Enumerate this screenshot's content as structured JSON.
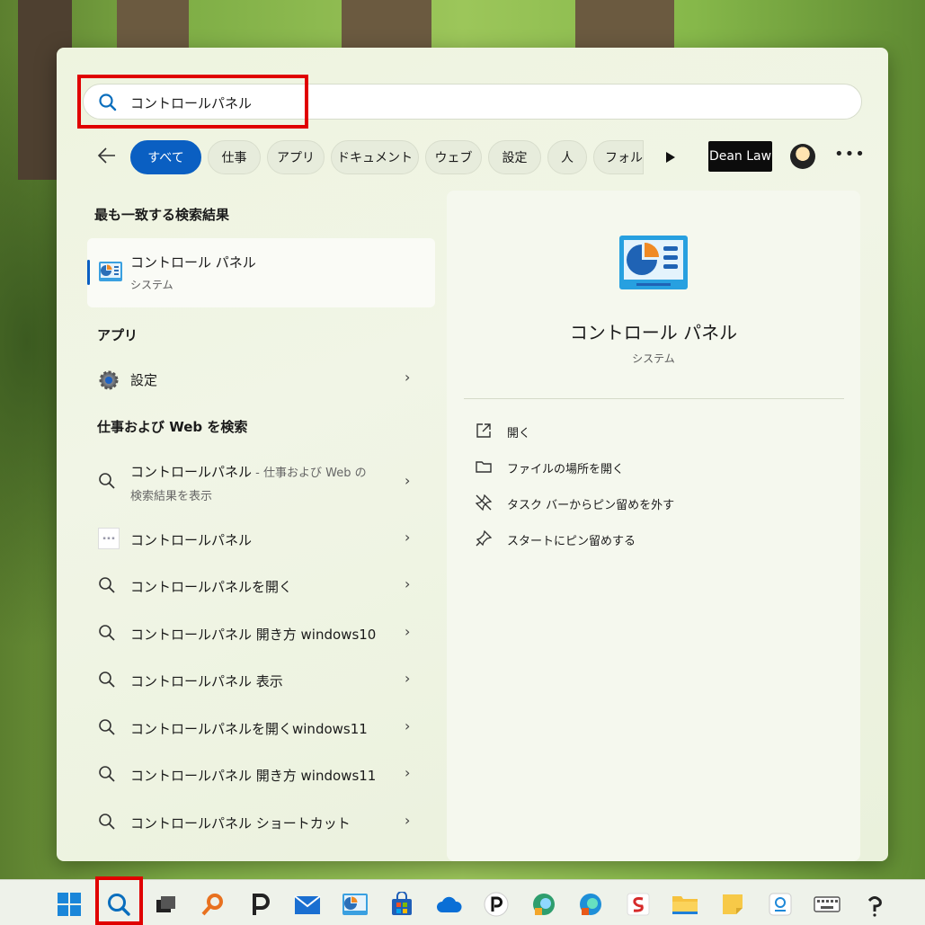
{
  "search": {
    "query": "コントロールパネル"
  },
  "filters": {
    "back_label": "←",
    "chips": [
      "すべて",
      "仕事",
      "アプリ",
      "ドキュメント",
      "ウェブ",
      "設定",
      "人",
      "フォルダ"
    ],
    "account_name": "Dean Law",
    "more_label": "•••"
  },
  "left": {
    "best_match_heading": "最も一致する検索結果",
    "best_match": {
      "title": "コントロール パネル",
      "subtitle": "システム"
    },
    "apps_heading": "アプリ",
    "apps": [
      {
        "label": "設定"
      }
    ],
    "web_heading": "仕事および Web を検索",
    "web_first": {
      "main": "コントロールパネル",
      "suffix": " - 仕事および Web の検索結果を表示"
    },
    "web_results": [
      "コントロールパネル",
      "コントロールパネルを開く",
      "コントロールパネル 開き方 windows10",
      "コントロールパネル 表示",
      "コントロールパネルを開くwindows11",
      "コントロールパネル 開き方 windows11",
      "コントロールパネル ショートカット"
    ],
    "chevron": "›"
  },
  "detail": {
    "title": "コントロール パネル",
    "category": "システム",
    "actions": [
      "開く",
      "ファイルの場所を開く",
      "タスク バーからピン留めを外す",
      "スタートにピン留めする"
    ]
  },
  "taskbar": {
    "icons": [
      "windows-start-icon",
      "search-icon",
      "task-view-icon",
      "magnifier-app-icon",
      "p-app-icon",
      "mail-icon",
      "control-panel-icon",
      "store-icon",
      "onedrive-icon",
      "p-circle-app-icon",
      "edge-canary-icon",
      "edge-dev-icon",
      "s-app-icon",
      "file-explorer-icon",
      "sticky-notes-icon",
      "photos-icon",
      "keyboard-icon",
      "clip-studio-icon"
    ]
  },
  "colors": {
    "accent": "#0a5fc2",
    "highlight": "#e00000"
  }
}
